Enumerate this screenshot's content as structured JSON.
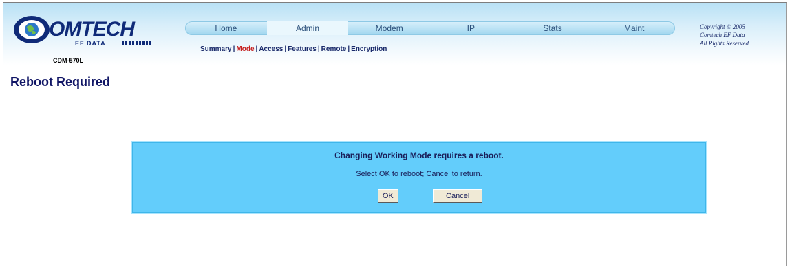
{
  "brand": {
    "logo_text": "OMTECH",
    "logo_sub": "EF DATA",
    "model": "CDM-570L"
  },
  "nav": {
    "items": [
      {
        "label": "Home"
      },
      {
        "label": "Admin"
      },
      {
        "label": "Modem"
      },
      {
        "label": "IP"
      },
      {
        "label": "Stats"
      },
      {
        "label": "Maint"
      }
    ],
    "active": "Admin"
  },
  "subnav": {
    "items": [
      {
        "label": "Summary"
      },
      {
        "label": "Mode"
      },
      {
        "label": "Access"
      },
      {
        "label": "Features"
      },
      {
        "label": "Remote"
      },
      {
        "label": "Encryption"
      }
    ],
    "current": "Mode"
  },
  "copyright": {
    "line1": "Copyright © 2005",
    "line2": "Comtech EF Data",
    "line3": "All Rights Reserved"
  },
  "page_title": "Reboot Required",
  "dialog": {
    "heading": "Changing Working Mode requires a reboot.",
    "message": "Select OK to reboot; Cancel to return.",
    "ok_label": "OK",
    "cancel_label": "Cancel"
  },
  "colors": {
    "dialog_bg": "#63cdfb",
    "title_color": "#101565",
    "current_link": "#c62020"
  }
}
